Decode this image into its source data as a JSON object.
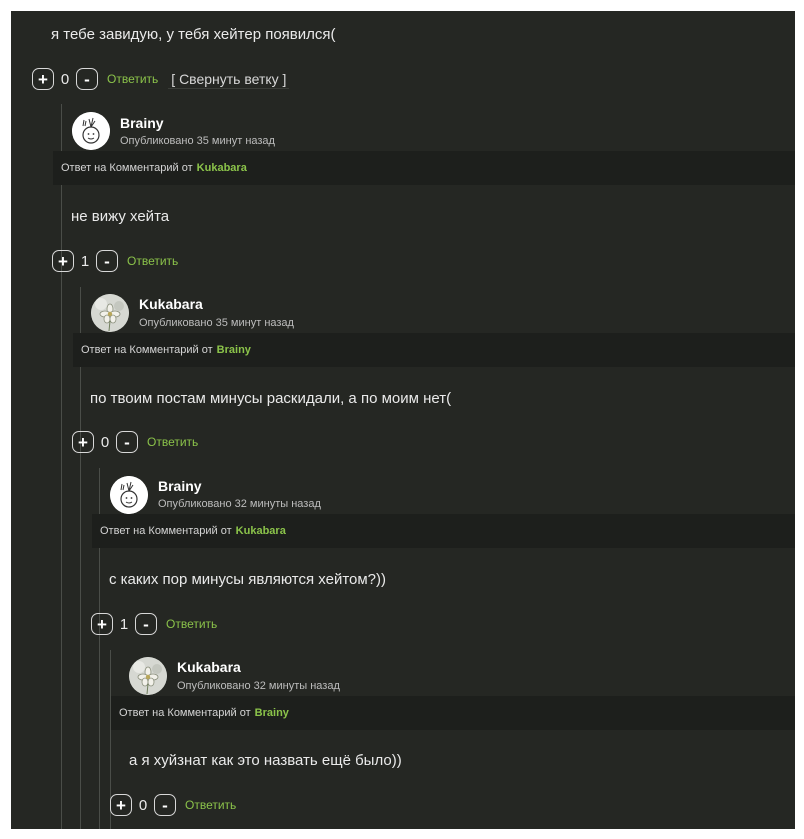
{
  "reply_link_label": "Ответить",
  "collapse_label": "[ Свернуть ветку ]",
  "reply_to_prefix": "Ответ на Комментарий от",
  "top": {
    "text": "я тебе завидую, у тебя хейтер появился(",
    "score": "0"
  },
  "comments": [
    {
      "author": "Brainy",
      "published": "Опубликовано 35 минут назад",
      "reply_to": "Kukabara",
      "text": "не вижу хейта",
      "score": "1",
      "avatar_icon": "onion-doodle-avatar"
    },
    {
      "author": "Kukabara",
      "published": "Опубликовано 35 минут назад",
      "reply_to": "Brainy",
      "text": "по твоим постам минусы раскидали, а по моим нет(",
      "score": "0",
      "avatar_icon": "flower-photo-avatar"
    },
    {
      "author": "Brainy",
      "published": "Опубликовано 32 минуты назад",
      "reply_to": "Kukabara",
      "text": "с каких пор минусы являются хейтом?))",
      "score": "1",
      "avatar_icon": "onion-doodle-avatar"
    },
    {
      "author": "Kukabara",
      "published": "Опубликовано 32 минуты назад",
      "reply_to": "Brainy",
      "text": "а я хуйзнат как это назвать ещё было))",
      "score": "0",
      "avatar_icon": "flower-photo-avatar"
    }
  ],
  "colors": {
    "background": "#252723",
    "reply_bar": "#1d1f1c",
    "accent_green": "#8bc34a",
    "text": "#eaeaea"
  }
}
